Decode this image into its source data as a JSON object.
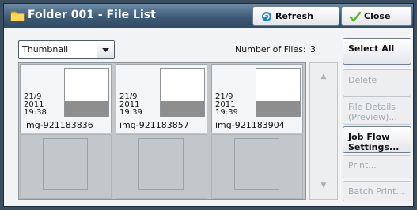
{
  "window": {
    "title": "Folder 001 - File List"
  },
  "toolbar": {
    "refresh_label": "Refresh",
    "close_label": "Close"
  },
  "view": {
    "selected": "Thumbnail"
  },
  "files": {
    "count_label": "Number of Files:",
    "count": "3",
    "items": [
      {
        "date": "21/9\n2011\n19:38",
        "name": "img-921183836"
      },
      {
        "date": "21/9\n2011\n19:39",
        "name": "img-921183857"
      },
      {
        "date": "21/9\n2011\n19:39",
        "name": "img-921183904"
      }
    ]
  },
  "actions": {
    "select_all": "Select All",
    "delete": "Delete",
    "file_details": "File Details\n(Preview)...",
    "job_flow": "Job Flow\nSettings...",
    "print": "Print...",
    "batch_print": "Batch Print..."
  },
  "colors": {
    "titlebar": "#3d5a76",
    "panel": "#f2f3f4",
    "accent_refresh": "#1e86c8",
    "accent_close": "#5cb82a"
  },
  "icons": [
    "folder-icon",
    "refresh-icon",
    "checkmark-icon",
    "chevron-down-icon",
    "scroll-up-icon",
    "scroll-down-icon"
  ]
}
